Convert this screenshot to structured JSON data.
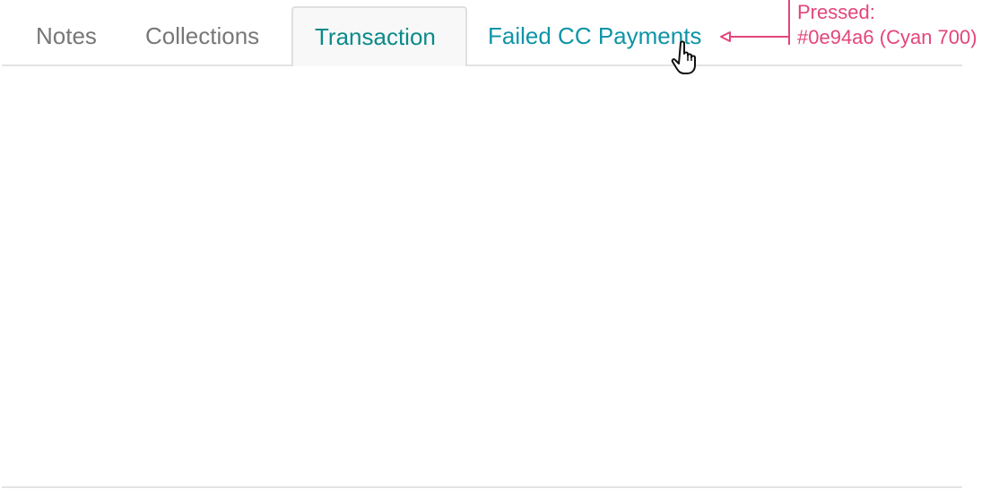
{
  "tabs": {
    "notes": "Notes",
    "collections": "Collections",
    "transaction": "Transaction",
    "failed_cc": "Failed CC Payments"
  },
  "active_tab": "Transaction",
  "annotation": {
    "line1": "Pressed:",
    "line2": "#0e94a6 (Cyan 700)"
  },
  "colors": {
    "pressed_tab": "#0e94a6",
    "active_tab": "#0b8a8a",
    "inactive_tab": "#777777",
    "annotation": "#e3457b"
  },
  "cursor_icon": "hand-pointer-icon"
}
